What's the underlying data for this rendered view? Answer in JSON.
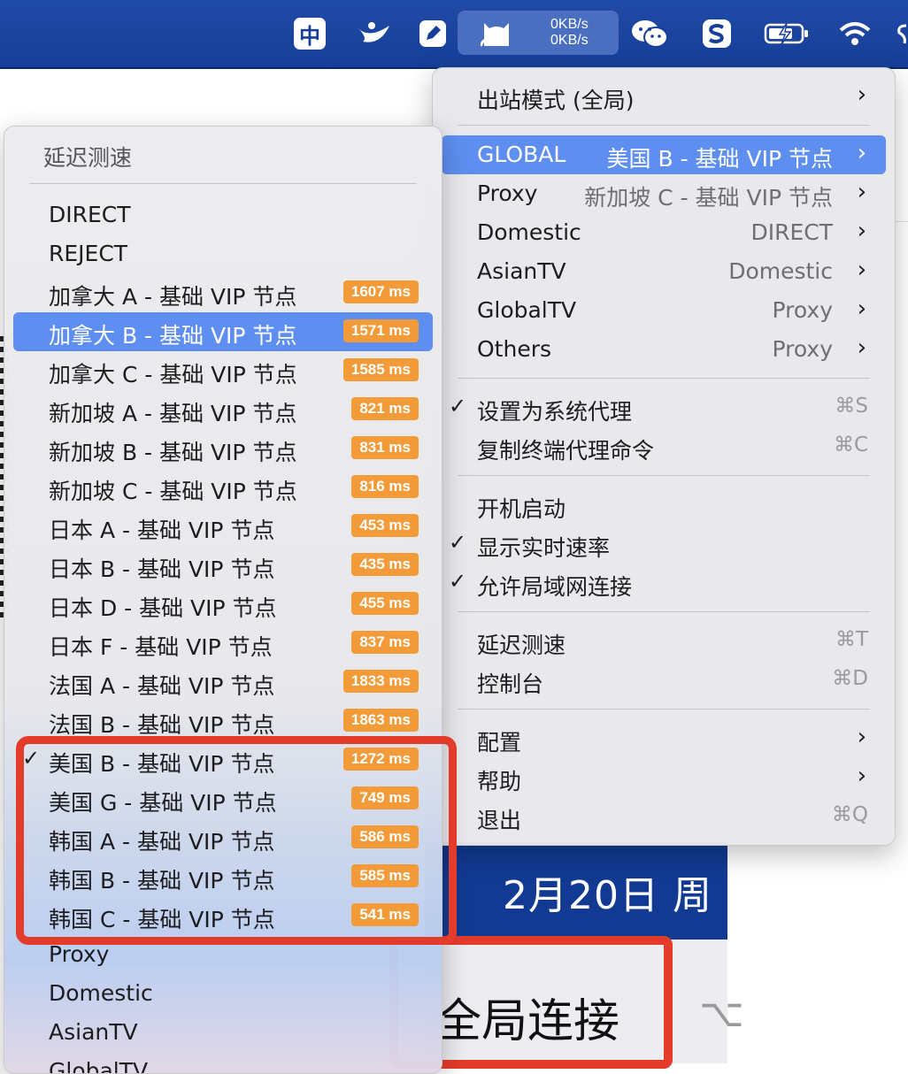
{
  "menubar": {
    "ime_label": "中",
    "speed_up": "0KB/s",
    "speed_down": "0KB/s"
  },
  "background": {
    "date_text": "2月20日 周",
    "button_text": "全局连接",
    "key_hint": "⌥"
  },
  "main_menu": {
    "outbound_mode": "出站模式 (全局)",
    "groups": [
      {
        "name": "GLOBAL",
        "value": "美国 B - 基础 VIP 节点"
      },
      {
        "name": "Proxy",
        "value": "新加坡 C - 基础 VIP 节点"
      },
      {
        "name": "Domestic",
        "value": "DIRECT"
      },
      {
        "name": "AsianTV",
        "value": "Domestic"
      },
      {
        "name": "GlobalTV",
        "value": "Proxy"
      },
      {
        "name": "Others",
        "value": "Proxy"
      }
    ],
    "set_system_proxy": "设置为系统代理",
    "set_system_proxy_shortcut": "⌘S",
    "copy_terminal_cmd": "复制终端代理命令",
    "copy_terminal_cmd_shortcut": "⌘C",
    "launch_at_login": "开机启动",
    "show_speed": "显示实时速率",
    "allow_lan": "允许局域网连接",
    "latency_test": "延迟测速",
    "latency_test_shortcut": "⌘T",
    "dashboard": "控制台",
    "dashboard_shortcut": "⌘D",
    "config": "配置",
    "help": "帮助",
    "quit": "退出",
    "quit_shortcut": "⌘Q",
    "checkmark": "✓",
    "chevron": "›"
  },
  "sub_menu": {
    "header": "延迟测速",
    "items": [
      {
        "label": "DIRECT",
        "latency": ""
      },
      {
        "label": "REJECT",
        "latency": ""
      },
      {
        "label": "加拿大 A - 基础 VIP 节点",
        "latency": "1607 ms"
      },
      {
        "label": "加拿大 B - 基础 VIP 节点",
        "latency": "1571 ms"
      },
      {
        "label": "加拿大 C - 基础 VIP 节点",
        "latency": "1585 ms"
      },
      {
        "label": "新加坡 A - 基础 VIP 节点",
        "latency": "821 ms"
      },
      {
        "label": "新加坡 B - 基础 VIP 节点",
        "latency": "831 ms"
      },
      {
        "label": "新加坡 C - 基础 VIP 节点",
        "latency": "816 ms"
      },
      {
        "label": "日本 A - 基础 VIP 节点",
        "latency": "453 ms"
      },
      {
        "label": "日本 B - 基础 VIP 节点",
        "latency": "435 ms"
      },
      {
        "label": "日本 D - 基础 VIP 节点",
        "latency": "455 ms"
      },
      {
        "label": "日本 F - 基础 VIP 节点",
        "latency": "837 ms"
      },
      {
        "label": "法国 A - 基础 VIP 节点",
        "latency": "1833 ms"
      },
      {
        "label": "法国 B - 基础 VIP 节点",
        "latency": "1863 ms"
      },
      {
        "label": "美国 B - 基础 VIP 节点",
        "latency": "1272 ms"
      },
      {
        "label": "美国 G - 基础 VIP 节点",
        "latency": "749 ms"
      },
      {
        "label": "韩国 A - 基础 VIP 节点",
        "latency": "586 ms"
      },
      {
        "label": "韩国 B - 基础 VIP 节点",
        "latency": "585 ms"
      },
      {
        "label": "韩国 C - 基础 VIP 节点",
        "latency": "541 ms"
      },
      {
        "label": "Proxy",
        "latency": ""
      },
      {
        "label": "Domestic",
        "latency": ""
      },
      {
        "label": "AsianTV",
        "latency": ""
      },
      {
        "label": "GlobalTV",
        "latency": ""
      }
    ]
  },
  "colors": {
    "accent": "#5e8ff0",
    "latency_badge": "#f29b38",
    "highlight_box": "#e43c2a",
    "menubar": "#1f4aa6"
  }
}
